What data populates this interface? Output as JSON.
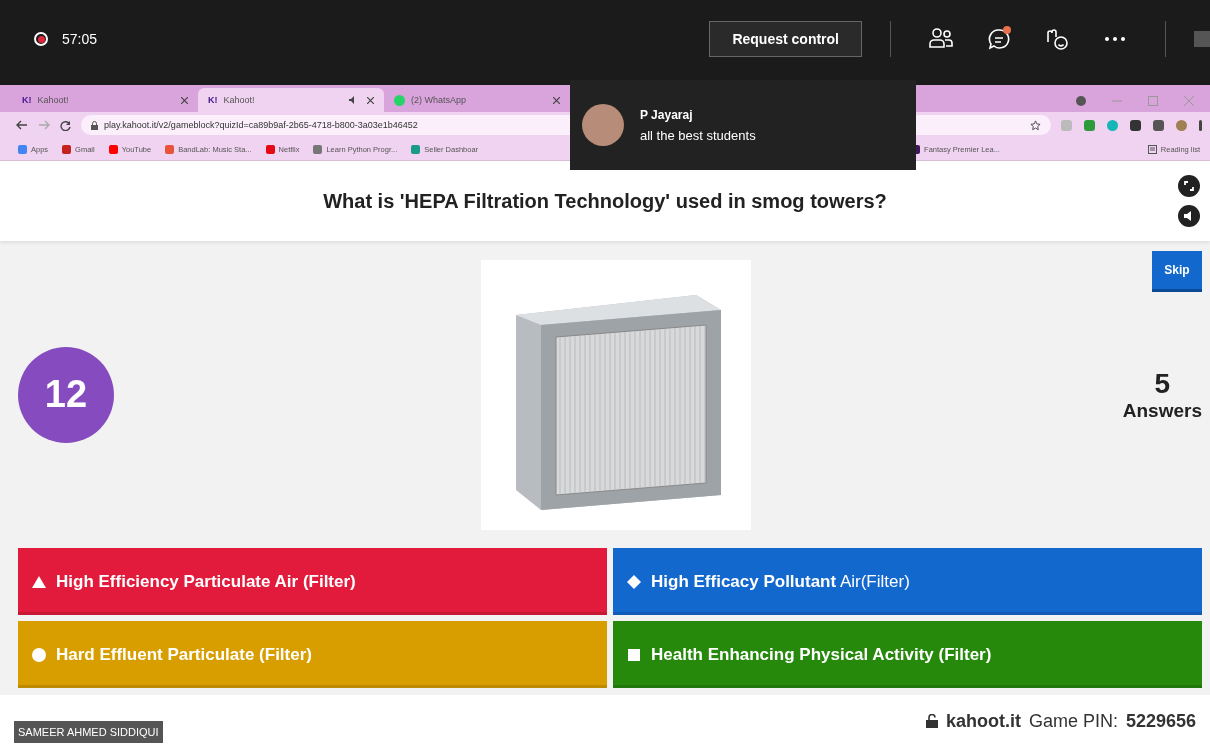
{
  "meeting_bar": {
    "recording_time": "57:05",
    "request_button": "Request control"
  },
  "toast": {
    "sender": "P Jayaraj",
    "message": "all the best students"
  },
  "browser": {
    "tabs": [
      {
        "label": "Kahoot!",
        "kind": "kahoot",
        "icon_text": "K!",
        "selected": false,
        "muted_icon": false
      },
      {
        "label": "Kahoot!",
        "kind": "kahoot",
        "icon_text": "K!",
        "selected": true,
        "muted_icon": true
      },
      {
        "label": "(2) WhatsApp",
        "kind": "whatsapp",
        "selected": false,
        "muted_icon": false
      }
    ],
    "url": "play.kahoot.it/v2/gameblock?quizId=ca89b9af-2b65-4718-b800-3a03e1b46452",
    "bookmarks": [
      {
        "label": "Apps",
        "color": "#4285f4"
      },
      {
        "label": "Gmail",
        "color": "#c5221f"
      },
      {
        "label": "YouTube",
        "color": "#ff0000"
      },
      {
        "label": "BandLab: Music Sta...",
        "color": "#e8543a"
      },
      {
        "label": "Netflix",
        "color": "#e50914"
      },
      {
        "label": "Learn Python Progr...",
        "color": "#777777"
      },
      {
        "label": "Seller Dashboar",
        "color": "#1a9b8a"
      }
    ],
    "bookmarks_right": [
      {
        "label": "Fantasy Premier Lea...",
        "color": "#3d195b"
      }
    ],
    "reading_list": "Reading list"
  },
  "quiz": {
    "question": "What is 'HEPA Filtration Technology' used in smog towers?",
    "timer": "12",
    "skip": "Skip",
    "answer_count": "5",
    "answer_label": "Answers",
    "answers": [
      {
        "kind": "triangle",
        "text": "**High Efficiency Particulate Air (Filter)**",
        "color": "#e21b3c"
      },
      {
        "kind": "diamond",
        "text": "**High Efficacy Pollutant** Air(Filter)",
        "color": "#1368ce"
      },
      {
        "kind": "circle",
        "text": "**Hard Effluent Particulate (Filter)**",
        "color": "#d89e00"
      },
      {
        "kind": "square",
        "text": "**Health Enhancing Physical Activity (Filter)**",
        "color": "#26890c"
      }
    ],
    "presenter": "SAMEER AHMED SIDDIQUI",
    "site": "kahoot.it",
    "pin_label": "Game PIN:",
    "pin": "5229656"
  }
}
